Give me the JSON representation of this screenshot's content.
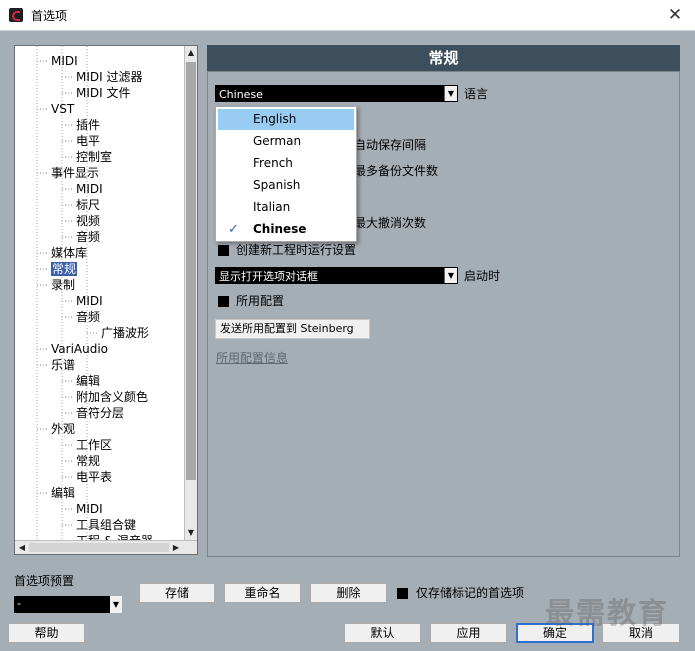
{
  "window": {
    "title": "首选项",
    "close_glyph": "✕"
  },
  "tree": {
    "nodes": [
      {
        "label": "MIDI",
        "level": 1
      },
      {
        "label": "MIDI 过滤器",
        "level": 2
      },
      {
        "label": "MIDI 文件",
        "level": 2
      },
      {
        "label": "VST",
        "level": 1
      },
      {
        "label": "插件",
        "level": 2
      },
      {
        "label": "电平",
        "level": 2
      },
      {
        "label": "控制室",
        "level": 2
      },
      {
        "label": "事件显示",
        "level": 1
      },
      {
        "label": "MIDI",
        "level": 2
      },
      {
        "label": "标尺",
        "level": 2
      },
      {
        "label": "视频",
        "level": 2
      },
      {
        "label": "音频",
        "level": 2
      },
      {
        "label": "媒体库",
        "level": 1
      },
      {
        "label": "常规",
        "level": 1,
        "selected": true
      },
      {
        "label": "录制",
        "level": 1
      },
      {
        "label": "MIDI",
        "level": 2
      },
      {
        "label": "音频",
        "level": 2
      },
      {
        "label": "广播波形",
        "level": 3
      },
      {
        "label": "VariAudio",
        "level": 1
      },
      {
        "label": "乐谱",
        "level": 1
      },
      {
        "label": "编辑",
        "level": 2
      },
      {
        "label": "附加含义颜色",
        "level": 2
      },
      {
        "label": "音符分层",
        "level": 2
      },
      {
        "label": "外观",
        "level": 1
      },
      {
        "label": "工作区",
        "level": 2
      },
      {
        "label": "常规",
        "level": 2
      },
      {
        "label": "电平表",
        "level": 2
      },
      {
        "label": "编辑",
        "level": 1
      },
      {
        "label": "MIDI",
        "level": 2
      },
      {
        "label": "工具组合键",
        "level": 2
      },
      {
        "label": "工程 & 混音器",
        "level": 2
      }
    ]
  },
  "panel": {
    "header": "常规",
    "language": {
      "value": "Chinese",
      "label": "语言"
    },
    "autosave_label": "自动保存间隔",
    "backup_label": "最多备份文件数",
    "undo_label": "最大撤消次数",
    "run_setup": "创建新工程时运行设置",
    "startup": {
      "value": "显示打开选项对话框",
      "label": "启动时"
    },
    "profile": "所用配置",
    "send_button": "发送所用配置到 Steinberg",
    "profile_info": "所用配置信息"
  },
  "language_dropdown": {
    "items": [
      {
        "label": "English",
        "highlighted": true
      },
      {
        "label": "German"
      },
      {
        "label": "French"
      },
      {
        "label": "Spanish"
      },
      {
        "label": "Italian"
      },
      {
        "label": "Chinese",
        "checked": true
      }
    ],
    "check_glyph": "✓"
  },
  "presets": {
    "label": "首选项预置",
    "value": "-",
    "store": "存储",
    "rename": "重命名",
    "delete": "删除",
    "only_marked": "仅存储标记的首选项"
  },
  "footer": {
    "help": "帮助",
    "default": "默认",
    "apply": "应用",
    "ok": "确定",
    "cancel": "取消"
  },
  "watermark": "最需教育",
  "glyphs": {
    "down": "▼",
    "up": "▲",
    "left": "◀",
    "right": "▶"
  }
}
